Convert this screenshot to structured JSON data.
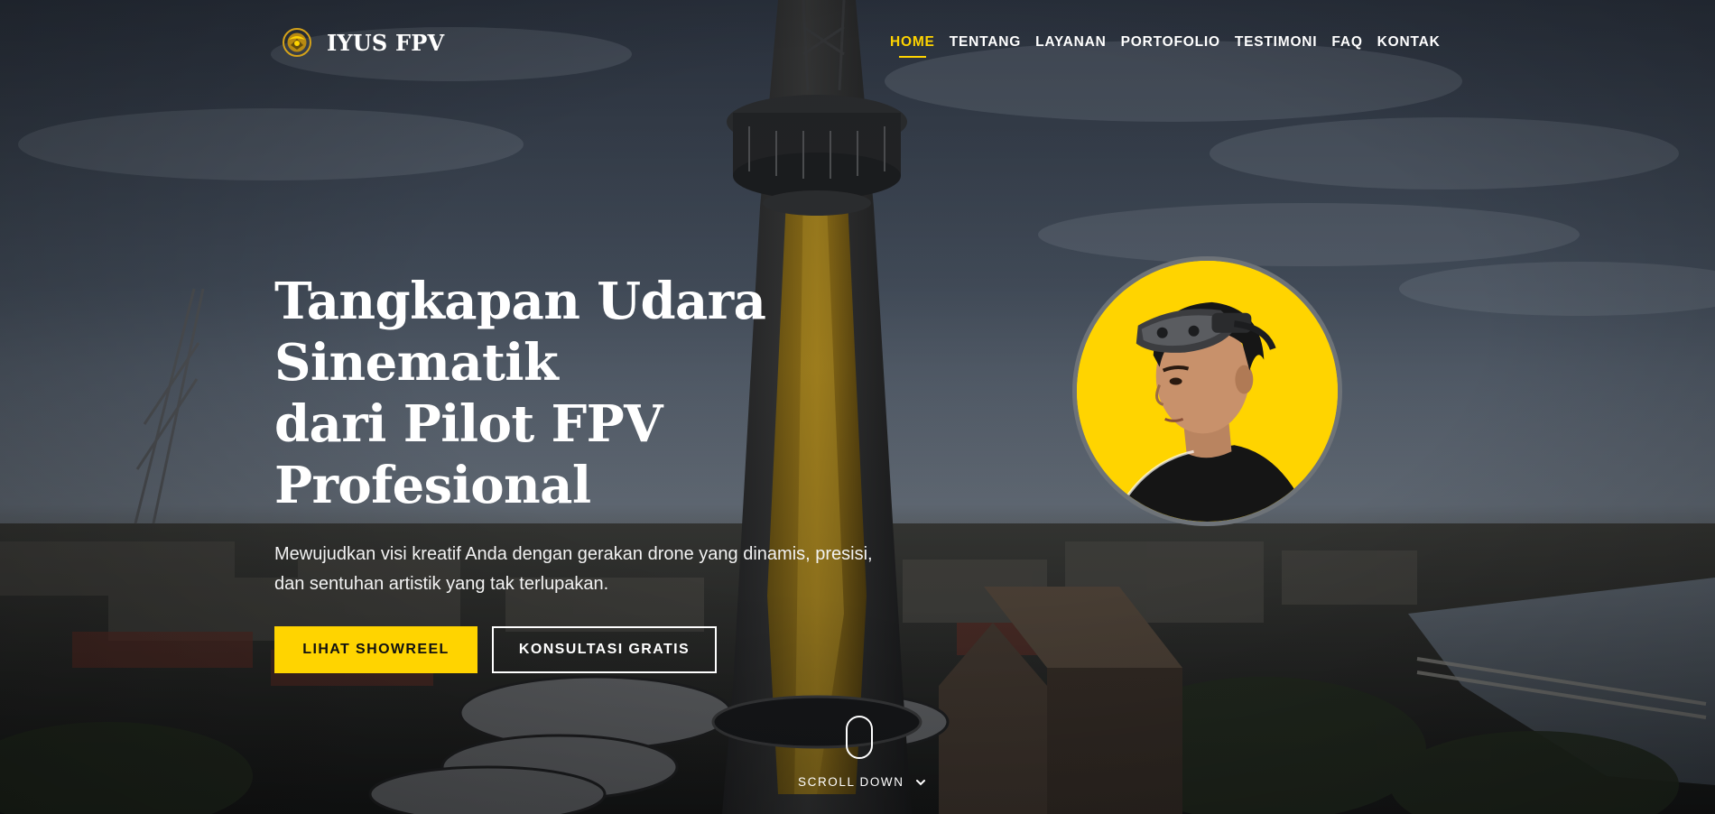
{
  "brand": {
    "name": "IYUS FPV",
    "logo_icon": "brand-emblem-icon"
  },
  "nav": {
    "items": [
      {
        "label": "HOME",
        "active": true
      },
      {
        "label": "TENTANG",
        "active": false
      },
      {
        "label": "LAYANAN",
        "active": false
      },
      {
        "label": "PORTOFOLIO",
        "active": false
      },
      {
        "label": "TESTIMONI",
        "active": false
      },
      {
        "label": "FAQ",
        "active": false
      },
      {
        "label": "KONTAK",
        "active": false
      }
    ]
  },
  "hero": {
    "title_line1": "Tangkapan Udara Sinematik",
    "title_line2": "dari Pilot FPV Profesional",
    "subtitle_line1": "Mewujudkan visi kreatif Anda dengan gerakan drone yang dinamis, presisi,",
    "subtitle_line2": "dan sentuhan artistik yang tak terlupakan.",
    "primary_button": "LIHAT SHOWREEL",
    "secondary_button": "KONSULTASI GRATIS"
  },
  "scroll": {
    "label": "SCROLL DOWN",
    "icon": "chevron-down-icon",
    "mouse_icon": "mouse-scroll-icon"
  },
  "colors": {
    "accent": "#ffd400",
    "text": "#ffffff",
    "avatar_ring": "#6e7378"
  }
}
